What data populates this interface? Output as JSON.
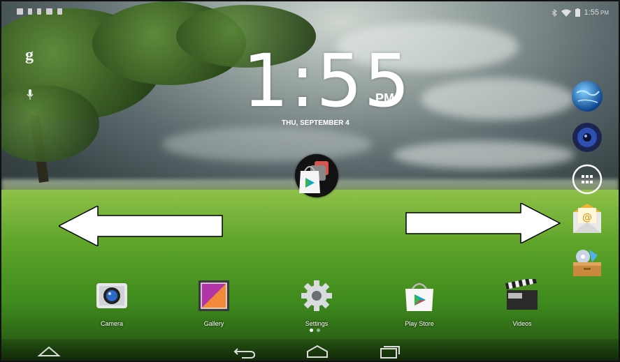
{
  "status_bar": {
    "time": "1:55",
    "ampm": "PM",
    "left_icons": [
      "mail-icon",
      "usb-icon",
      "download-icon",
      "image-icon",
      "barcode-icon"
    ],
    "right_icons": [
      "bluetooth-icon",
      "wifi-icon",
      "battery-icon"
    ]
  },
  "left_widgets": {
    "google_icon": "g",
    "mic_icon": "mic-icon"
  },
  "clock": {
    "time": "1:55",
    "ampm": "PM",
    "date": "THU, SEPTEMBER 4"
  },
  "center_folder": {
    "icon": "play-store-folder-icon"
  },
  "arrows": {
    "left": "left-arrow",
    "right": "right-arrow"
  },
  "right_dock": [
    "browser-globe-icon",
    "music-speaker-icon",
    "all-apps-icon",
    "email-icon",
    "file-manager-icon"
  ],
  "apps": [
    {
      "label": "Camera",
      "icon": "camera-icon"
    },
    {
      "label": "Gallery",
      "icon": "gallery-icon"
    },
    {
      "label": "Settings",
      "icon": "settings-gear-icon"
    },
    {
      "label": "Play Store",
      "icon": "play-store-icon"
    },
    {
      "label": "Videos",
      "icon": "clapperboard-icon"
    }
  ],
  "page_indicator": {
    "pages": 2,
    "current": 1
  },
  "nav_bar": [
    "up-icon",
    "back-icon",
    "home-icon",
    "recents-icon"
  ],
  "colors": {
    "accent_email": "#f2b233",
    "globe": "#1e73c8",
    "grass": "#5fa52a"
  }
}
